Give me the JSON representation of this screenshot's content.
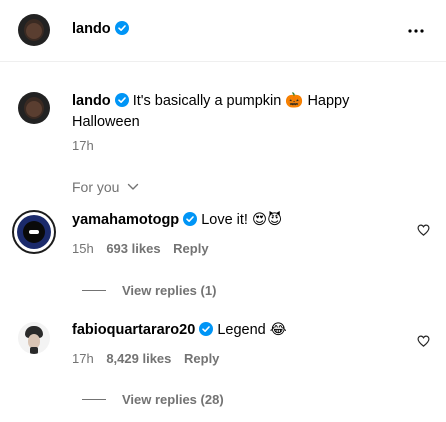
{
  "header": {
    "username": "lando",
    "more_icon": "more-horizontal-icon"
  },
  "caption": {
    "username": "lando",
    "text_line1": "It's basically a pumpkin 🎃 Happy",
    "text_line2": "Halloween",
    "time": "17h"
  },
  "filter": {
    "label": "For you"
  },
  "comments": [
    {
      "username": "yamahamotogp",
      "text": "Love it! 😍😈",
      "time": "15h",
      "likes": "693 likes",
      "reply_label": "Reply",
      "view_replies": "View replies (1)"
    },
    {
      "username": "fabioquartararo20",
      "text": "Legend 😂",
      "time": "17h",
      "likes": "8,429 likes",
      "reply_label": "Reply",
      "view_replies": "View replies (28)"
    }
  ],
  "colors": {
    "verified": "#0095f6",
    "secondary_text": "#737373",
    "divider": "#efefef"
  }
}
